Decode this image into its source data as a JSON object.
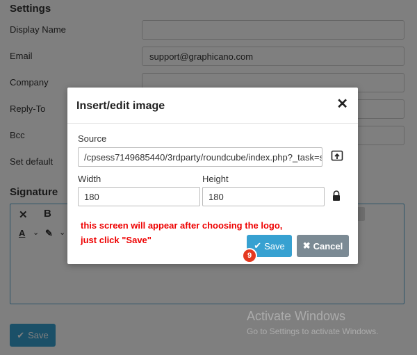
{
  "settings": {
    "title": "Settings",
    "fields": [
      {
        "label": "Display Name",
        "value": ""
      },
      {
        "label": "Email",
        "value": "support@graphicano.com"
      },
      {
        "label": "Company",
        "value": ""
      },
      {
        "label": "Reply-To",
        "value": ""
      },
      {
        "label": "Bcc",
        "value": ""
      },
      {
        "label": "Set default",
        "value": ""
      }
    ],
    "signature_title": "Signature",
    "save_label": "Save"
  },
  "watermark": {
    "line1": "Activate Windows",
    "line2": "Go to Settings to activate Windows."
  },
  "dialog": {
    "title": "Insert/edit image",
    "source_label": "Source",
    "source_value": "/cpsess7149685440/3rdparty/roundcube/index.php?_task=se",
    "width_label": "Width",
    "width_value": "180",
    "height_label": "Height",
    "height_value": "180",
    "note_line1": "this screen will appear after choosing the logo,",
    "note_line2": "just click \"Save\"",
    "save_label": "Save",
    "cancel_label": "Cancel",
    "step_number": "9"
  },
  "colors": {
    "primary": "#37a1d1",
    "cancel": "#7b8a94",
    "note": "#e00000",
    "badge": "#e53920"
  }
}
